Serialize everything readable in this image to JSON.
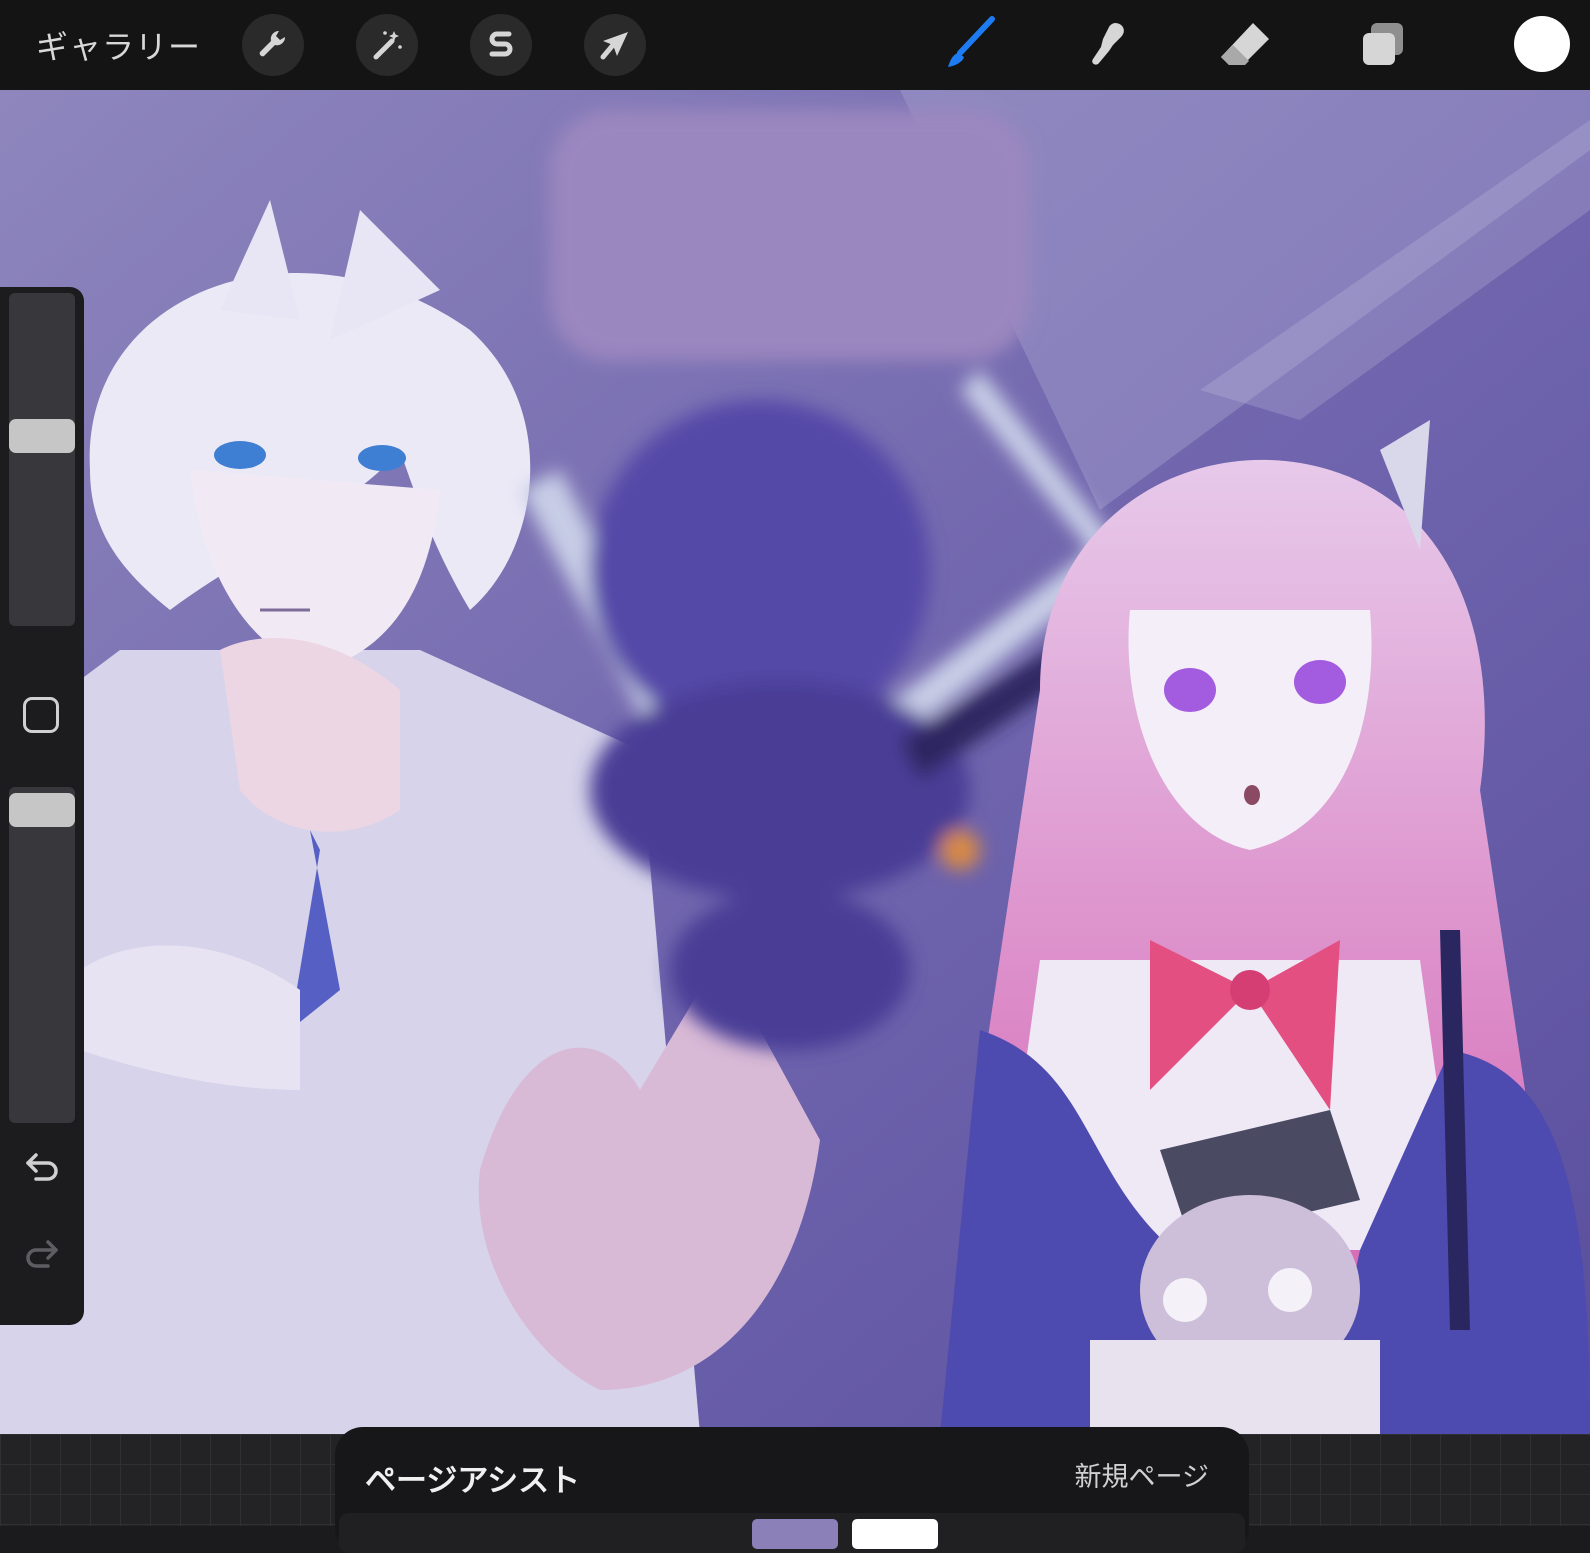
{
  "toolbar": {
    "gallery_label": "ギャラリー",
    "left_tools": [
      {
        "icon": "wrench-icon",
        "name": "actions"
      },
      {
        "icon": "magic-wand-icon",
        "name": "adjustments"
      },
      {
        "icon": "selection-s-icon",
        "name": "selection"
      },
      {
        "icon": "arrow-cursor-icon",
        "name": "transform"
      }
    ],
    "right_tools": [
      {
        "icon": "brush-icon",
        "name": "paint",
        "active": true
      },
      {
        "icon": "smudge-icon",
        "name": "smudge"
      },
      {
        "icon": "eraser-icon",
        "name": "eraser"
      },
      {
        "icon": "layers-icon",
        "name": "layers"
      }
    ],
    "current_color": "#ffffff",
    "active_color": "#1e7cf2"
  },
  "sidebar": {
    "brush_size_level": 0.58,
    "opacity_level": 0.98,
    "modify_icon": "square-icon",
    "undo_icon": "undo-icon",
    "redo_icon": "redo-icon"
  },
  "page_assist": {
    "title": "ページアシスト",
    "new_page_label": "新規ページ"
  }
}
